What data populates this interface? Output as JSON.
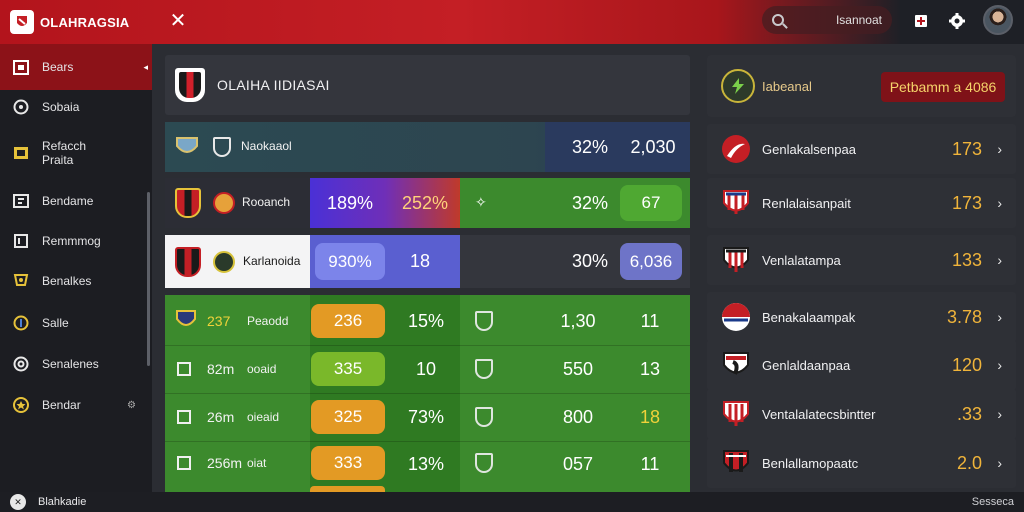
{
  "app": {
    "brand": "OLAHRAGSIA",
    "close_glyph": "✕",
    "search_text": "Isannoat",
    "accent": "#c41f25"
  },
  "sidebar": {
    "items": [
      {
        "label": "Bears",
        "icon": "calendar-icon"
      },
      {
        "label": "Sobaia",
        "icon": "globe-icon"
      },
      {
        "label": "Refacch\nPraita",
        "icon": "folder-icon"
      },
      {
        "label": "Bendame",
        "icon": "grid-icon"
      },
      {
        "label": "Remmmog",
        "icon": "square-icon"
      },
      {
        "label": "Benalkes",
        "icon": "trophy-icon"
      },
      {
        "label": "Salle",
        "icon": "ball-icon"
      },
      {
        "label": "Senalenes",
        "icon": "circle-icon"
      },
      {
        "label": "Bendar",
        "icon": "star-icon"
      }
    ],
    "collapse_glyph": "◂"
  },
  "bottom": {
    "left_label": "Blahkadie",
    "right_label": "Sesseca"
  },
  "main": {
    "title": "OLAIHA IIDIASAI",
    "rows": [
      {
        "team": "Naokaaol",
        "c1": "",
        "c2": "",
        "c3": "32%",
        "c4": "2,030"
      },
      {
        "team": "Rooanch",
        "c1": "189%",
        "c2": "252%",
        "c3": "32%",
        "c4": "67"
      },
      {
        "team": "Karlanoida",
        "c1": "930%",
        "c2": "18",
        "c3": "30%",
        "c4": "6,036"
      }
    ],
    "stats": [
      {
        "a": "237",
        "b": "Peaodd",
        "pill": "236",
        "pct": "15%",
        "val": "1,30",
        "last": "11"
      },
      {
        "a": "82m",
        "b": "ooaid",
        "pill": "335",
        "pct": "10",
        "val": "550",
        "last": "13"
      },
      {
        "a": "26m",
        "b": "oieaid",
        "pill": "325",
        "pct": "73%",
        "val": "800",
        "last": "18"
      },
      {
        "a": "256m",
        "b": "oiat",
        "pill": "333",
        "pct": "13%",
        "val": "057",
        "last": "11"
      }
    ]
  },
  "right": {
    "title": "Iabeanal",
    "badge": "Petbamm a 4086",
    "items": [
      {
        "name": "Genlakalsenpaa",
        "value": "173"
      },
      {
        "name": "Renlalaisanpait",
        "value": "173"
      },
      {
        "name": "Venlalatampa",
        "value": "133"
      },
      {
        "name": "Benakalaampak",
        "value": "3.78"
      },
      {
        "name": "Genlaldaanpaa",
        "value": "120"
      },
      {
        "name": "Ventalalatecsbintter",
        "value": ".33"
      },
      {
        "name": "Benlallamopaatc",
        "value": "2.0"
      }
    ],
    "chevron": "›"
  }
}
